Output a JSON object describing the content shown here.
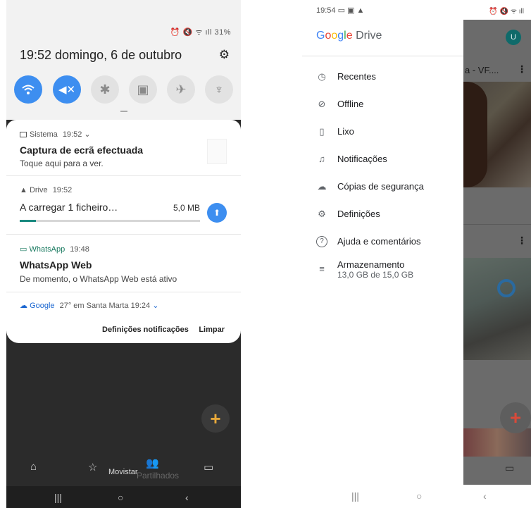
{
  "left": {
    "status_icons": "⏰ 🔇 ᯤ ıll 31%",
    "date_time": "19:52  domingo, 6 de outubro",
    "quick_settings": [
      {
        "name": "wifi-toggle",
        "icon": "wifi-icon",
        "glyph": "◠",
        "state": "on"
      },
      {
        "name": "mute-toggle",
        "icon": "mute-icon",
        "glyph": "🔇",
        "state": "on"
      },
      {
        "name": "bluetooth-toggle",
        "icon": "bluetooth-icon",
        "glyph": "✱",
        "state": "off"
      },
      {
        "name": "auto-rotate-toggle",
        "icon": "rotate-icon",
        "glyph": "▣",
        "state": "off"
      },
      {
        "name": "airplane-toggle",
        "icon": "airplane-icon",
        "glyph": "✈",
        "state": "off"
      },
      {
        "name": "flashlight-toggle",
        "icon": "flashlight-icon",
        "glyph": "🔦",
        "state": "off"
      }
    ],
    "notifications": {
      "system": {
        "app": "Sistema",
        "time": "19:52",
        "title": "Captura de ecrã efectuada",
        "text": "Toque aqui para a ver."
      },
      "drive": {
        "app": "Drive",
        "time": "19:52",
        "title": "A carregar 1 ficheiro…",
        "size": "5,0 MB",
        "progress": 0.09
      },
      "whatsapp": {
        "app": "WhatsApp",
        "time": "19:48",
        "title": "WhatsApp Web",
        "text": "De momento, o WhatsApp Web está ativo"
      },
      "google": {
        "app": "Google",
        "text": "27° em Santa Marta  19:24"
      }
    },
    "footer": {
      "settings": "Definições notificações",
      "clear": "Limpar"
    },
    "carrier": "Movistar",
    "bottom_nav_shared": "Partilhados"
  },
  "right": {
    "status_time": "19:54",
    "status_right": "⏰ 🔇 ᯤ ıll",
    "logo": {
      "g1": "G",
      "g2": "o",
      "g3": "o",
      "g4": "g",
      "g5": "l",
      "g6": "e",
      "drive": " Drive"
    },
    "menu": [
      {
        "icon": "clock-icon",
        "glyph": "◷",
        "label": "Recentes"
      },
      {
        "icon": "offline-icon",
        "glyph": "✓",
        "label": "Offline"
      },
      {
        "icon": "trash-icon",
        "glyph": "▯",
        "label": "Lixo"
      },
      {
        "icon": "bell-icon",
        "glyph": "▲",
        "label": "Notificações"
      },
      {
        "icon": "backup-icon",
        "glyph": "☁",
        "label": "Cópias de segurança"
      },
      {
        "icon": "settings-icon",
        "glyph": "⚙",
        "label": "Definições"
      },
      {
        "icon": "help-icon",
        "glyph": "?",
        "label": "Ajuda e comentários"
      },
      {
        "icon": "storage-icon",
        "glyph": "≡",
        "label": "Armazenamento"
      }
    ],
    "storage_usage": "13,0 GB de 15,0 GB",
    "background_file_title": "a - VF....",
    "avatar_letter": "U"
  },
  "colors": {
    "accent_blue": "#3d8ef0",
    "progress_teal": "#1a8a80",
    "avatar_teal": "#0f6a6a"
  }
}
